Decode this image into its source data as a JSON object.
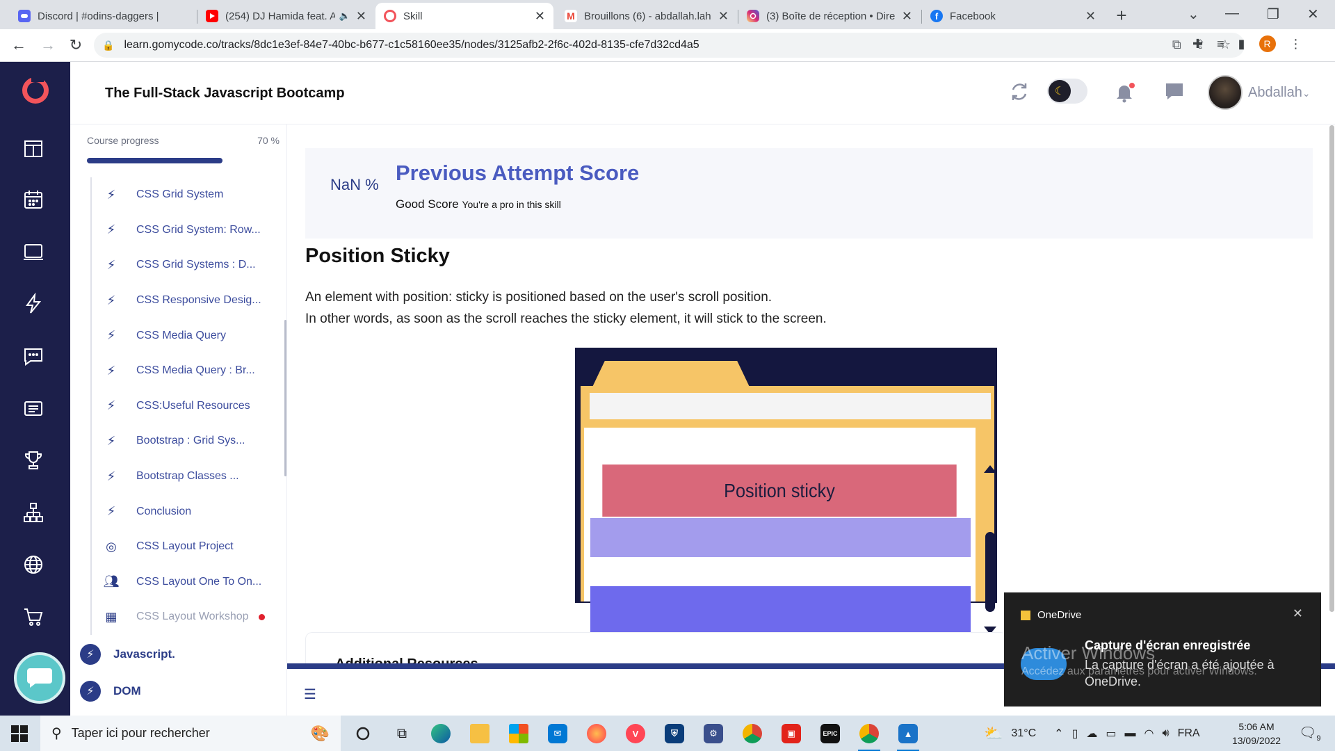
{
  "browser": {
    "tabs": [
      {
        "title": "Discord | #odins-daggers | ",
        "icon": "discord-icon",
        "color": "#5865f2"
      },
      {
        "title": "(254) DJ Hamida feat. A",
        "icon": "youtube-icon",
        "color": "#ff0000"
      },
      {
        "title": "Skill",
        "icon": "gomycode-icon",
        "color": "#f2545b",
        "active": true
      },
      {
        "title": "Brouillons (6) - abdallah.lah",
        "icon": "gmail-icon",
        "color": "#ea4335"
      },
      {
        "title": "(3) Boîte de réception • Dire",
        "icon": "instagram-icon",
        "color": "#d6249f"
      },
      {
        "title": "Facebook",
        "icon": "facebook-icon",
        "color": "#1877f2"
      }
    ],
    "url": "learn.gomycode.co/tracks/8dc1e3ef-84e7-40bc-b677-c1c58160ee35/nodes/3125afb2-2f6c-402d-8135-cfe7d32cd4a5",
    "profile_initial": "R"
  },
  "header": {
    "title": "The Full-Stack Javascript Bootcamp",
    "username": "Abdallah"
  },
  "sidebar": {
    "progress_label": "Course progress",
    "progress_value": "70 %",
    "progress_fraction": 0.7,
    "lessons": [
      {
        "label": "CSS Grid System",
        "icon": "bolt-icon"
      },
      {
        "label": "CSS Grid System: Row...",
        "icon": "bolt-icon"
      },
      {
        "label": "CSS Grid Systems : D...",
        "icon": "bolt-icon"
      },
      {
        "label": "CSS Responsive Desig...",
        "icon": "bolt-icon"
      },
      {
        "label": "CSS Media Query",
        "icon": "bolt-icon"
      },
      {
        "label": "CSS Media Query : Br...",
        "icon": "bolt-icon"
      },
      {
        "label": "CSS:Useful Resources",
        "icon": "bolt-icon"
      },
      {
        "label": "Bootstrap : Grid Sys...",
        "icon": "bolt-icon"
      },
      {
        "label": "Bootstrap Classes ...",
        "icon": "bolt-icon"
      },
      {
        "label": "Conclusion",
        "icon": "bolt-icon"
      },
      {
        "label": "CSS Layout Project",
        "icon": "target-icon"
      },
      {
        "label": "CSS Layout One To On...",
        "icon": "people-icon"
      },
      {
        "label": "CSS Layout Workshop",
        "icon": "workshop-icon",
        "dim": true,
        "dot": true
      }
    ],
    "modules": [
      {
        "label": "Javascript."
      },
      {
        "label": "DOM"
      }
    ]
  },
  "score": {
    "percent": "NaN %",
    "title": "Previous Attempt Score",
    "label": "Good Score",
    "sub": "You're a pro in this skill"
  },
  "content": {
    "title": "Position Sticky",
    "para1": "An element with position: sticky is positioned based on the user's scroll position.",
    "para2": "In other words, as soon as the scroll reaches the sticky element, it will stick to the screen.",
    "illustration_label": "Position sticky",
    "resources_title": "Additional Resources"
  },
  "toast": {
    "app": "OneDrive",
    "title": "Capture d'écran enregistrée",
    "body": "La capture d'écran a été ajoutée à OneDrive."
  },
  "watermark": {
    "line1": "Activer Windows",
    "line2": "Accédez aux paramètres pour activer Windows."
  },
  "taskbar": {
    "search_placeholder": "Taper ici pour rechercher",
    "weather": "31°C",
    "language": "FRA",
    "time": "5:06 AM",
    "date": "13/09/2022",
    "notification_count": "9"
  }
}
